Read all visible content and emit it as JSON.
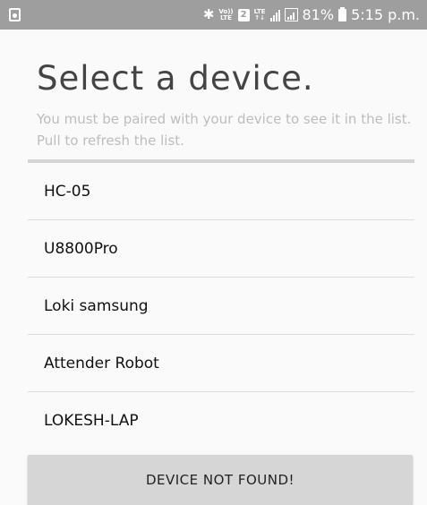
{
  "status_bar": {
    "volte_top": "Vo))",
    "volte_bottom": "LTE",
    "sim_number": "2",
    "lte_top": "LTE",
    "lte_bottom": "↑↓",
    "battery_percent": "81%",
    "time": "5:15 p.m.",
    "icons": [
      "notification-icon",
      "bluetooth-icon",
      "signal-icon",
      "battery-icon"
    ]
  },
  "header": {
    "title": "Select a device.",
    "subtitle": "You must be paired with your device to see it in the list. Pull to refresh the list."
  },
  "devices": [
    {
      "name": "HC-05"
    },
    {
      "name": "U8800Pro"
    },
    {
      "name": "Loki samsung"
    },
    {
      "name": "Attender Robot"
    },
    {
      "name": "LOKESH-LAP"
    }
  ],
  "footer": {
    "button_label": "DEVICE NOT FOUND!"
  },
  "colors": {
    "status_bar": "#9e9e9e",
    "background": "#fafafa",
    "title_text": "#444444",
    "subtitle_text": "#bdbdbd",
    "button_bg": "#d6d6d6"
  }
}
